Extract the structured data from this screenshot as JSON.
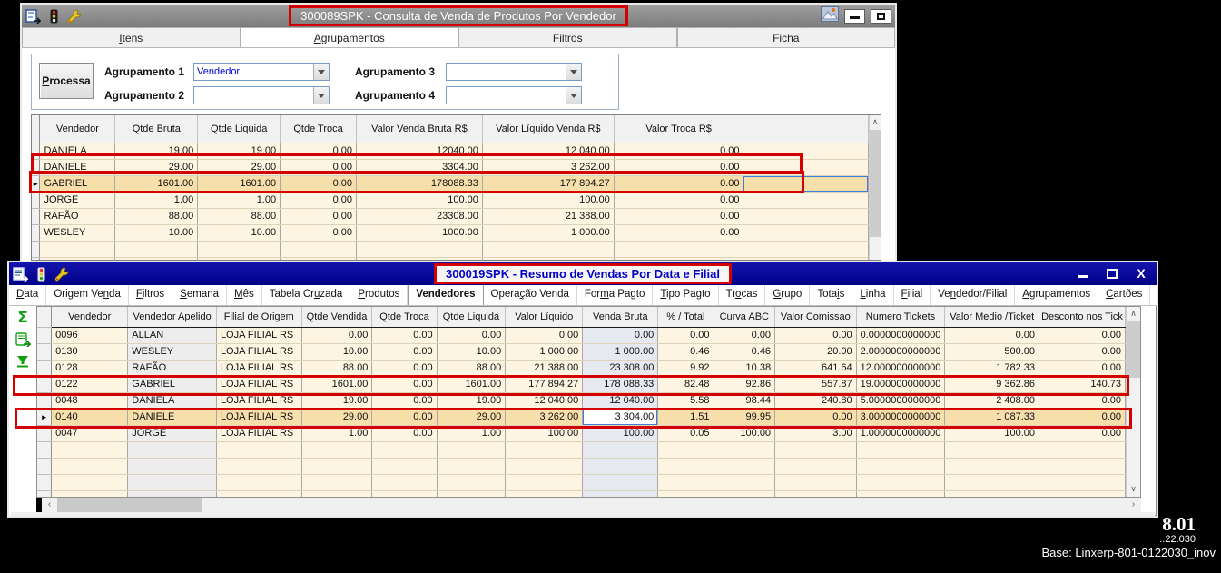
{
  "colors": {
    "annotation_red": "#d40000",
    "row_cream": "#fdf5e1",
    "row_selected_orange": "#f7dfab",
    "titlebar_inactive_gray": "#8c8c8c",
    "titlebar_active_navy": "#000087",
    "title_text_blue": "#0000c8",
    "sidebar_icon_green": "#12a012"
  },
  "window1": {
    "title": "300089SPK - Consulta de Venda de Produtos Por Vendedor",
    "tabs": [
      {
        "label": "Itens",
        "u": 0,
        "active": false
      },
      {
        "label": "Agrupamentos",
        "u": 0,
        "active": true
      },
      {
        "label": "Filtros",
        "u": null,
        "active": false
      },
      {
        "label": "Ficha",
        "u": null,
        "active": false
      }
    ],
    "processa_label": "Processa",
    "processa_underline": 0,
    "agrupamentos": [
      {
        "label": "Agrupamento 1",
        "value": "Vendedor"
      },
      {
        "label": "Agrupamento 2",
        "value": ""
      },
      {
        "label": "Agrupamento 3",
        "value": ""
      },
      {
        "label": "Agrupamento 4",
        "value": ""
      }
    ],
    "grid": {
      "columns": [
        "Vendedor",
        "Qtde Bruta",
        "Qtde Liquida",
        "Qtde Troca",
        "Valor Venda Bruta R$",
        "Valor Líquido Venda R$",
        "Valor Troca R$",
        ""
      ],
      "rows": [
        [
          "DANIELA",
          "19.00",
          "19.00",
          "0.00",
          "12040.00",
          "12 040.00",
          "0.00",
          ""
        ],
        [
          "DANIELE",
          "29.00",
          "29.00",
          "0.00",
          "3304.00",
          "3 262.00",
          "0.00",
          ""
        ],
        [
          "GABRIEL",
          "1601.00",
          "1601.00",
          "0.00",
          "178088.33",
          "177 894.27",
          "0.00",
          ""
        ],
        [
          "JORGE",
          "1.00",
          "1.00",
          "0.00",
          "100.00",
          "100.00",
          "0.00",
          ""
        ],
        [
          "RAFÃO",
          "88.00",
          "88.00",
          "0.00",
          "23308.00",
          "21 388.00",
          "0.00",
          ""
        ],
        [
          "WESLEY",
          "10.00",
          "10.00",
          "0.00",
          "1000.00",
          "1 000.00",
          "0.00",
          ""
        ]
      ],
      "selected_row": "GABRIEL",
      "focused_cell": {
        "row": "GABRIEL",
        "column_index": 7
      }
    }
  },
  "window2": {
    "title": "300019SPK - Resumo de Vendas Por Data e Filial",
    "tabs": [
      {
        "label": "Data",
        "u": 0
      },
      {
        "label": "Origem Venda",
        "u": 9
      },
      {
        "label": "Filtros",
        "u": 0
      },
      {
        "label": "Semana",
        "u": 0
      },
      {
        "label": "Mês",
        "u": 0
      },
      {
        "label": "Tabela Cruzada",
        "u": 9
      },
      {
        "label": "Produtos",
        "u": 0
      },
      {
        "label": "Vendedores",
        "u": null,
        "active": true
      },
      {
        "label": "Operação Venda",
        "u": 5
      },
      {
        "label": "Forma Pagto",
        "u": 3
      },
      {
        "label": "Tipo Pagto",
        "u": 0
      },
      {
        "label": "Trocas",
        "u": 2
      },
      {
        "label": "Grupo",
        "u": 0
      },
      {
        "label": "Totais",
        "u": 4
      },
      {
        "label": "Linha",
        "u": 0
      },
      {
        "label": "Filial",
        "u": 0
      },
      {
        "label": "Vendedor/Filial",
        "u": 2
      },
      {
        "label": "Agrupamentos",
        "u": 0
      },
      {
        "label": "Cartões",
        "u": 0
      }
    ],
    "sidebar_icons": [
      "sum-icon",
      "export-record-icon",
      "filter-icon"
    ],
    "grid": {
      "columns": [
        "Vendedor",
        "Vendedor Apelido",
        "Filial de Origem",
        "Qtde Vendida",
        "Qtde Troca",
        "Qtde Liquida",
        "Valor Líquido",
        "Venda Bruta",
        "% / Total",
        "Curva ABC",
        "Valor Comissao",
        "Numero Tickets",
        "Valor Medio /Ticket",
        "Desconto nos Tick"
      ],
      "rows": [
        [
          "0096",
          "ALLAN",
          "LOJA FILIAL RS",
          "0.00",
          "0.00",
          "0.00",
          "0.00",
          "0.00",
          "0.00",
          "0.00",
          "0.00",
          "0.0000000000000",
          "0.00",
          "0.00"
        ],
        [
          "0130",
          "WESLEY",
          "LOJA FILIAL RS",
          "10.00",
          "0.00",
          "10.00",
          "1 000.00",
          "1 000.00",
          "0.46",
          "0.46",
          "20.00",
          "2.0000000000000",
          "500.00",
          "0.00"
        ],
        [
          "0128",
          "RAFÃO",
          "LOJA FILIAL RS",
          "88.00",
          "0.00",
          "88.00",
          "21 388.00",
          "23 308.00",
          "9.92",
          "10.38",
          "641.64",
          "12.000000000000",
          "1 782.33",
          "0.00"
        ],
        [
          "0122",
          "GABRIEL",
          "LOJA FILIAL RS",
          "1601.00",
          "0.00",
          "1601.00",
          "177 894.27",
          "178 088.33",
          "82.48",
          "92.86",
          "557.87",
          "19.000000000000",
          "9 362.86",
          "140.73"
        ],
        [
          "0048",
          "DANIELA",
          "LOJA FILIAL RS",
          "19.00",
          "0.00",
          "19.00",
          "12 040.00",
          "12 040.00",
          "5.58",
          "98.44",
          "240.80",
          "5.0000000000000",
          "2 408.00",
          "0.00"
        ],
        [
          "0140",
          "DANIELE",
          "LOJA FILIAL RS",
          "29.00",
          "0.00",
          "29.00",
          "3 262.00",
          "3 304.00",
          "1.51",
          "99.95",
          "0.00",
          "3.0000000000000",
          "1 087.33",
          "0.00"
        ],
        [
          "0047",
          "JORGE",
          "LOJA FILIAL RS",
          "1.00",
          "0.00",
          "1.00",
          "100.00",
          "100.00",
          "0.05",
          "100.00",
          "3.00",
          "1.0000000000000",
          "100.00",
          "0.00"
        ]
      ],
      "selected_row": "0140",
      "focused_cell": {
        "row": "0140",
        "column": "Venda Bruta",
        "value": "3 304.00"
      }
    }
  },
  "annotations": {
    "window1_red_boxes": [
      "title",
      "row-DANIELE",
      "row-GABRIEL"
    ],
    "window2_red_boxes": [
      "title",
      "row-0122",
      "row-0140"
    ]
  },
  "status": {
    "version_major": "8.01",
    "version_minor": "..22.030",
    "base_label": "Base: Linxerp-801-0122030_inov"
  }
}
